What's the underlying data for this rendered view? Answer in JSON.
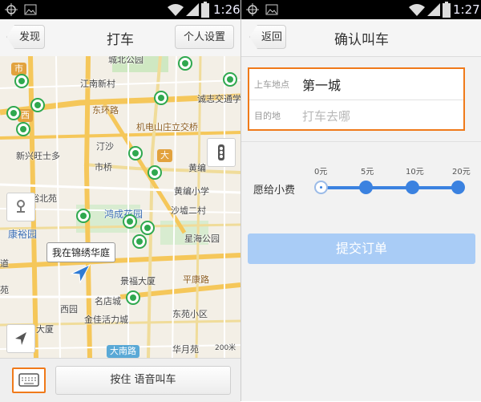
{
  "left": {
    "status": {
      "time": "1:26"
    },
    "nav": {
      "back_label": "发现",
      "title": "打车",
      "settings_label": "个人设置"
    },
    "map": {
      "labels": {
        "jiangnan": "江南新村",
        "dongbao": "东环路",
        "chengzhi": "诚志交通学",
        "jidian": "机电山庄立交桥",
        "tingsha": "汀沙",
        "xinxing": "新兴旺士多",
        "shiqiao": "市桥",
        "huangbian": "黄编",
        "yubei": "裕北苑",
        "hongcheng": "鸿成花园",
        "huangbianxx": "黄编小学",
        "shaxu": "沙墟二村",
        "kangyu": "康裕园",
        "xingdao": "星海公园",
        "jingfu": "景福大厦",
        "pingkang": "平康路",
        "mingdian": "名店城",
        "xiyuan": "西园",
        "jinjia": "金佳活力城",
        "dongyuan": "东苑小区",
        "daxia": "大厦",
        "danan": "大南路",
        "huayue": "华月苑",
        "scale": "200米",
        "chengbei": "城北公园",
        "shi": "市",
        "xi": "西",
        "da": "大",
        "dao": "道",
        "ku": "苑"
      },
      "callout": "我在锦绣华庭"
    },
    "voice_label": "按住 语音叫车",
    "accent": "#f07a1a",
    "car_color": "#2fa84f"
  },
  "right": {
    "status": {
      "time": "1:27"
    },
    "nav": {
      "back_label": "返回",
      "title": "确认叫车"
    },
    "form": {
      "pickup_label": "上车地点",
      "pickup_value": "第一城",
      "dest_label": "目的地",
      "dest_placeholder": "打车去哪"
    },
    "tip": {
      "label": "愿给小费",
      "options": [
        "0元",
        "5元",
        "10元",
        "20元"
      ],
      "selected": "0元"
    },
    "submit_label": "提交订单",
    "slider_color": "#3b82e0"
  },
  "icons": [
    "wifi-icon",
    "signal-icon",
    "battery-icon",
    "gps-icon",
    "image-icon",
    "traffic-icon",
    "route-icon",
    "locate-arrow-icon",
    "location-arrow-icon",
    "keyboard-icon"
  ]
}
